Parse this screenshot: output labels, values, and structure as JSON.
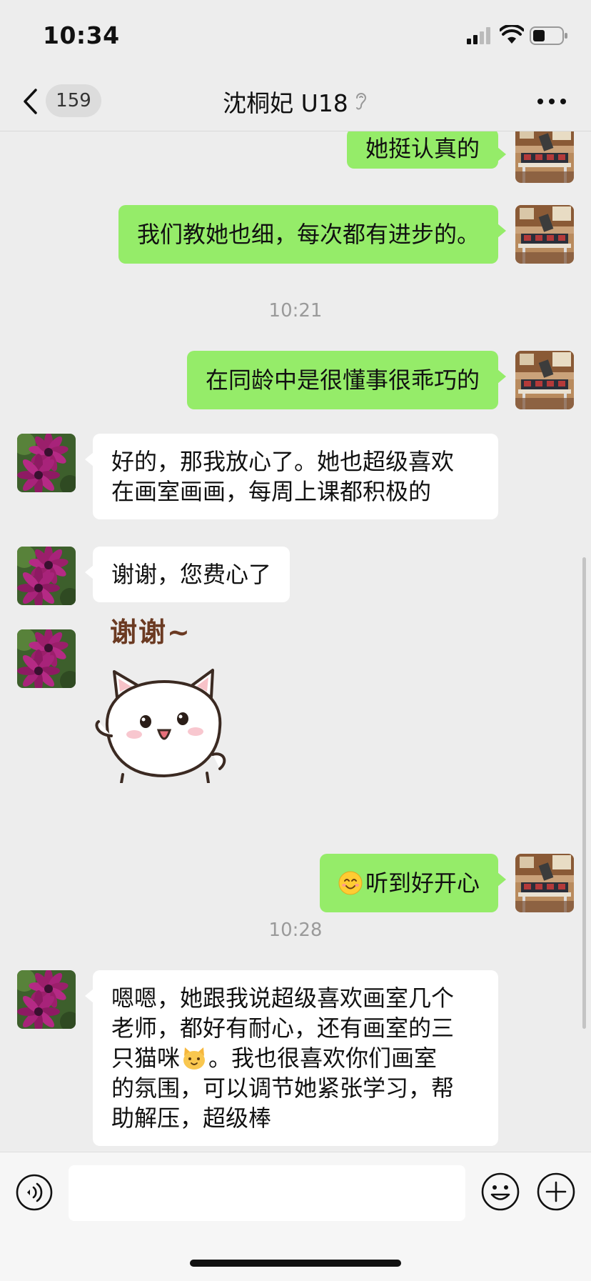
{
  "status_bar": {
    "time": "10:34"
  },
  "nav": {
    "unread_count": "159",
    "title": "沈桐妃 U18"
  },
  "messages": [
    {
      "side": "out",
      "text": "她挺认真的"
    },
    {
      "side": "out",
      "text": "我们教她也细，每次都有进步的。"
    },
    {
      "type": "time",
      "text": "10:21"
    },
    {
      "side": "out",
      "text": "在同龄中是很懂事很乖巧的"
    },
    {
      "side": "in",
      "lines": [
        "好的，那我放心了。她也超级喜欢",
        "在画室画画，每周上课都积极的"
      ]
    },
    {
      "side": "in",
      "text": "谢谢，您费心了"
    },
    {
      "side": "in",
      "type": "sticker",
      "text": "谢谢~"
    },
    {
      "side": "out",
      "emoji": "smiling-face",
      "text": "听到好开心"
    },
    {
      "type": "time",
      "text": "10:28"
    },
    {
      "side": "in",
      "lines": [
        "嗯嗯，她跟我说超级喜欢画室几个",
        "老师，都好有耐心，还有画室的三",
        "只猫咪",
        "。我也很喜欢你们画室",
        "的氛围，可以调节她紧张学习，帮",
        "助解压，超级棒"
      ]
    }
  ],
  "input": {
    "value": "",
    "placeholder": ""
  },
  "colors": {
    "background": "#ededed",
    "outgoing_bubble": "#95ec69",
    "incoming_bubble": "#ffffff",
    "timestamp": "#9a9a9a"
  },
  "icons": [
    "signal-icon",
    "wifi-icon",
    "battery-icon",
    "back-chevron-icon",
    "earpiece-icon",
    "more-icon",
    "voice-icon",
    "emoji-icon",
    "add-icon",
    "smiling-face-emoji",
    "cat-face-emoji"
  ]
}
